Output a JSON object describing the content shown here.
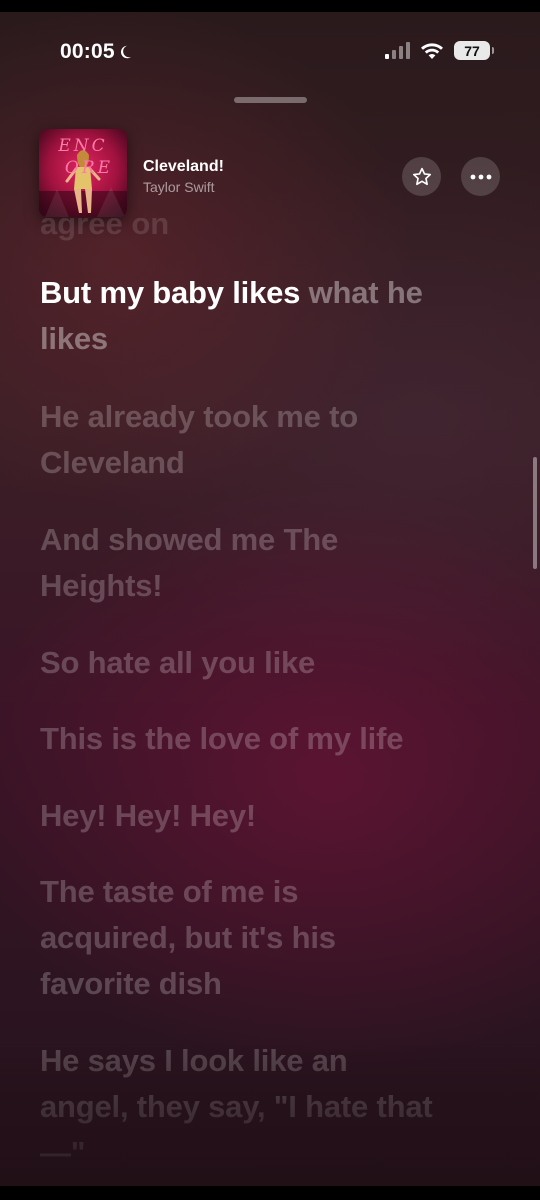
{
  "status_bar": {
    "time": "00:05",
    "battery": "77"
  },
  "now_playing": {
    "title": "Cleveland!",
    "artist": "Taylor Swift",
    "artwork_text": "ENCORE"
  },
  "lyrics": {
    "previous_partial": "agree on",
    "current": {
      "sung": "But my baby likes",
      "unsung": " what he likes"
    },
    "upcoming": [
      "He already took me to Cleveland",
      "And showed me The Heights!",
      "So hate all you like",
      "This is the love of my life",
      "Hey! Hey! Hey!",
      "The taste of me is acquired, but it's his favorite dish",
      "He says I look like an angel, they say, \"I hate that—\""
    ]
  },
  "colors": {
    "accent": "#ffffff",
    "background_top": "#2a1a1c",
    "background_bottom": "#221017"
  }
}
